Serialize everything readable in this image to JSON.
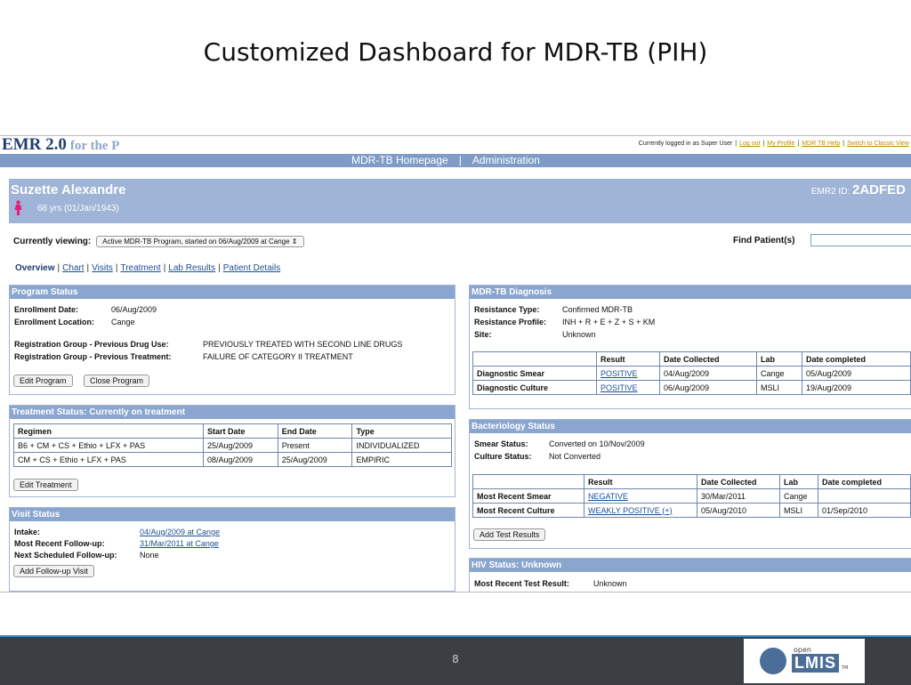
{
  "slide": {
    "title": "Customized Dashboard  for MDR-TB   (PIH)",
    "page_number": "8"
  },
  "header": {
    "logo_main": "EMR 2.0",
    "logo_sub": "for the P",
    "logged_in": "Currently logged in as Super User",
    "links": [
      "Log out",
      "My Profile",
      "MDR TB Help",
      "Switch to Classic View"
    ]
  },
  "nav": {
    "items": [
      "MDR-TB Homepage",
      "Administration"
    ],
    "separator": "|"
  },
  "patient": {
    "name": "Suzette Alexandre",
    "age": "68 yrs (01/Jan/1943)",
    "emr_id_label": "EMR2 ID:",
    "emr_id": "2ADFED",
    "gender_icon": "female-icon",
    "gender_color": "#e0207a"
  },
  "viewing": {
    "label": "Currently viewing:",
    "selected": "Active MDR-TB Program, started on 06/Aug/2009 at Cange",
    "find_label": "Find Patient(s)"
  },
  "tabs": [
    "Overview",
    "Chart",
    "Visits",
    "Treatment",
    "Lab Results",
    "Patient Details"
  ],
  "program_status": {
    "title": "Program Status",
    "enroll_date_label": "Enrollment Date:",
    "enroll_date": "06/Aug/2009",
    "enroll_loc_label": "Enrollment Location:",
    "enroll_loc": "Cange",
    "reg_drug_label": "Registration Group - Previous Drug Use:",
    "reg_drug": "PREVIOUSLY TREATED WITH SECOND LINE DRUGS",
    "reg_treat_label": "Registration Group - Previous Treatment:",
    "reg_treat": "FAILURE OF CATEGORY II TREATMENT",
    "edit_btn": "Edit Program",
    "close_btn": "Close Program"
  },
  "treatment_status": {
    "title": "Treatment Status: Currently on treatment",
    "headers": [
      "Regimen",
      "Start Date",
      "End Date",
      "Type"
    ],
    "rows": [
      [
        "B6 + CM + CS + Ethio + LFX + PAS",
        "25/Aug/2009",
        "Present",
        "INDIVIDUALIZED"
      ],
      [
        "CM + CS + Ethio + LFX + PAS",
        "08/Aug/2009",
        "25/Aug/2009",
        "EMPIRIC"
      ]
    ],
    "edit_btn": "Edit Treatment"
  },
  "visit_status": {
    "title": "Visit Status",
    "intake_label": "Intake:",
    "intake": "04/Aug/2009 at Cange",
    "followup_label": "Most Recent Follow-up:",
    "followup": "31/Mar/2011 at Cange",
    "next_label": "Next Scheduled Follow-up:",
    "next": "None",
    "add_btn": "Add Follow-up Visit"
  },
  "diagnosis": {
    "title": "MDR-TB Diagnosis",
    "resistance_type_label": "Resistance Type:",
    "resistance_type": "Confirmed MDR-TB",
    "resistance_profile_label": "Resistance Profile:",
    "resistance_profile": "INH + R + E + Z + S + KM",
    "site_label": "Site:",
    "site": "Unknown",
    "headers": [
      "",
      "Result",
      "Date Collected",
      "Lab",
      "Date completed"
    ],
    "rows": [
      [
        "Diagnostic Smear",
        "POSITIVE",
        "04/Aug/2009",
        "Cange",
        "05/Aug/2009"
      ],
      [
        "Diagnostic Culture",
        "POSITIVE",
        "06/Aug/2009",
        "MSLI",
        "19/Aug/2009"
      ]
    ]
  },
  "bacteriology": {
    "title": "Bacteriology Status",
    "smear_label": "Smear Status:",
    "smear": "Converted on 10/Nov/2009",
    "culture_label": "Culture Status:",
    "culture": "Not Converted",
    "headers": [
      "",
      "Result",
      "Date Collected",
      "Lab",
      "Date completed"
    ],
    "rows": [
      [
        "Most Recent Smear",
        "NEGATIVE",
        "30/Mar/2011",
        "Cange",
        ""
      ],
      [
        "Most Recent Culture",
        "WEAKLY POSITIVE (+)",
        "05/Aug/2010",
        "MSLI",
        "01/Sep/2010"
      ]
    ],
    "add_btn": "Add Test Results"
  },
  "hiv": {
    "title": "HIV Status: Unknown",
    "label": "Most Recent Test Result:",
    "value": "Unknown"
  }
}
